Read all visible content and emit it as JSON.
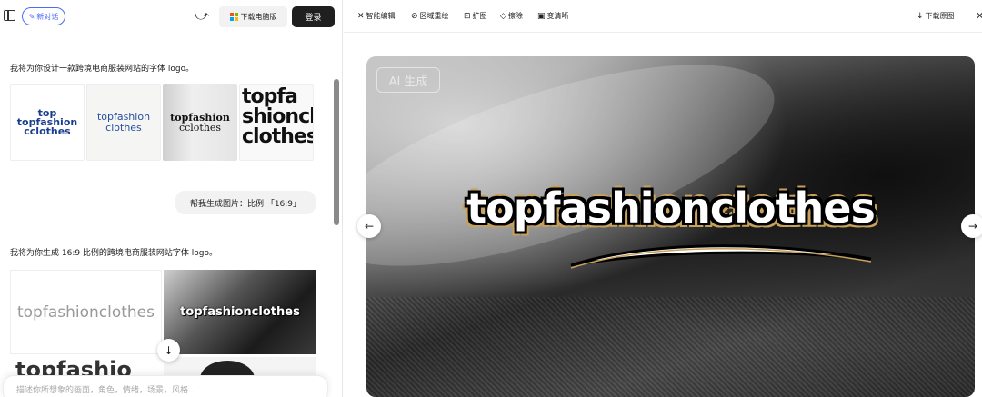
{
  "header": {
    "new_chat_label": "新对话",
    "download_pc_label": "下载电脑版",
    "login_label": "登录"
  },
  "chat": {
    "assistant_msg_1": "我将为你设计一款跨境电商服装网站的字体 logo。",
    "images_1": [
      {
        "name": "logo-option-1",
        "text": "top\ntopfashion\ncclothes"
      },
      {
        "name": "logo-option-2",
        "text": "topfashion\nclothes"
      },
      {
        "name": "logo-option-3",
        "text": "topfashion\ncclothes"
      },
      {
        "name": "logo-option-4",
        "text": "topfa\nshioncl\nclothes"
      }
    ],
    "user_msg": "帮我生成图片：比例 「16:9」",
    "assistant_msg_2": "我将为你生成 16:9 比例的跨境电商服装网站字体 logo。",
    "images_2": [
      {
        "name": "wide-logo-1",
        "text": "topfashionclothes"
      },
      {
        "name": "wide-logo-2",
        "text": "topfashionclothes"
      },
      {
        "name": "wide-logo-3",
        "text": "topfashio"
      },
      {
        "name": "wide-logo-4",
        "text": ""
      }
    ],
    "input_placeholder": "描述你所想象的画面，角色，情绪，场景，风格..."
  },
  "toolbar": {
    "items": [
      {
        "icon": "magic-edit-icon",
        "glyph": "✕",
        "label": "智能编辑"
      },
      {
        "icon": "region-redraw-icon",
        "glyph": "⊘",
        "label": "区域重绘"
      },
      {
        "icon": "expand-icon",
        "glyph": "⊡",
        "label": "扩图"
      },
      {
        "icon": "erase-icon",
        "glyph": "◇",
        "label": "擦除"
      },
      {
        "icon": "sharpen-icon",
        "glyph": "▣",
        "label": "变清晰"
      }
    ],
    "download_original_label": "下载原图"
  },
  "preview": {
    "ai_badge": "AI 生成",
    "logo_text": "topfashionclothes"
  }
}
